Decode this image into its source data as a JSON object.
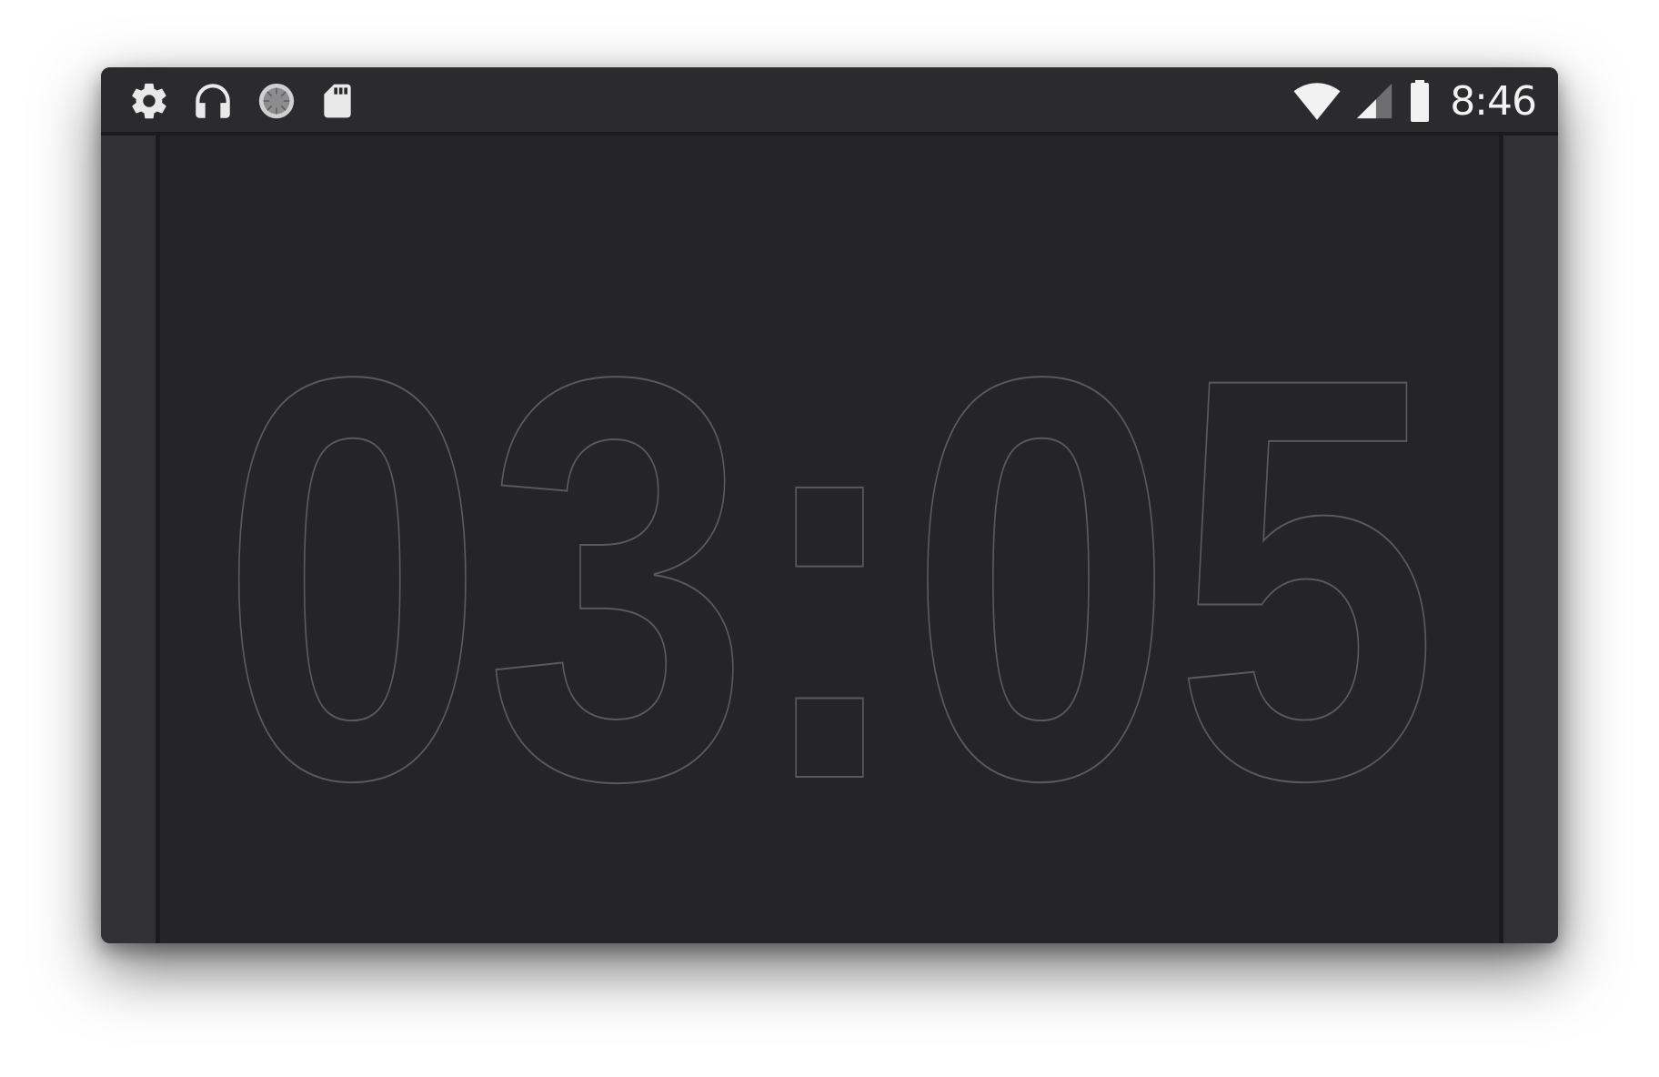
{
  "status_bar": {
    "left_icons": [
      "gear-icon",
      "headphones-icon",
      "spinner-icon",
      "sd-card-icon"
    ],
    "right_icons": [
      "wifi-icon",
      "cell-signal-icon",
      "battery-icon"
    ],
    "time": "8:46"
  },
  "clock": {
    "display": "03:05"
  },
  "colors": {
    "frame": "#2c2b2e",
    "panel": "#252527",
    "digit_outline": "#5a5a5d",
    "status_text": "#f2f2f2"
  }
}
